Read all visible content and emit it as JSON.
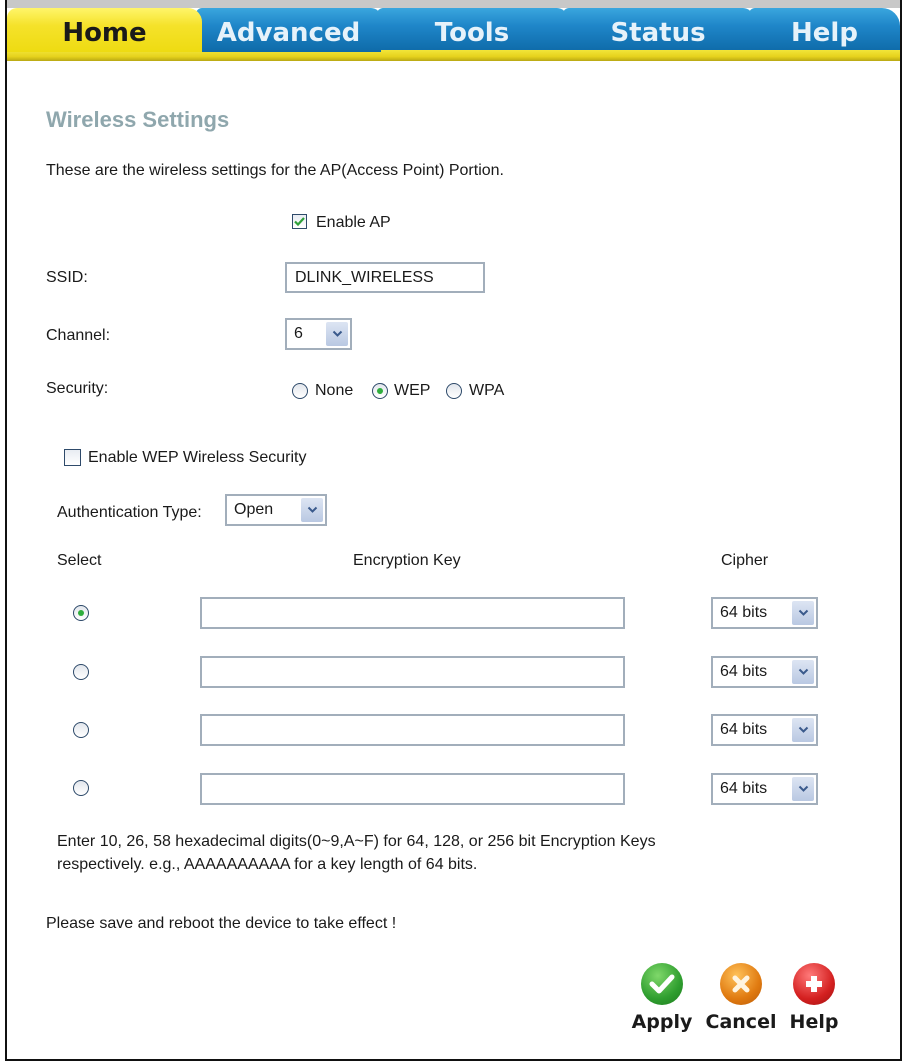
{
  "nav": {
    "tabs": [
      {
        "label": "Home",
        "active": true
      },
      {
        "label": "Advanced",
        "active": false
      },
      {
        "label": "Tools",
        "active": false
      },
      {
        "label": "Status",
        "active": false
      },
      {
        "label": "Help",
        "active": false
      }
    ]
  },
  "page": {
    "title": "Wireless Settings",
    "description": "These are the wireless settings for the AP(Access Point) Portion."
  },
  "form": {
    "enable_ap": {
      "label": "Enable AP",
      "checked": true
    },
    "ssid": {
      "label": "SSID:",
      "value": "DLINK_WIRELESS"
    },
    "channel": {
      "label": "Channel:",
      "value": "6"
    },
    "security": {
      "label": "Security:",
      "options": [
        "None",
        "WEP",
        "WPA"
      ],
      "selected": "WEP"
    },
    "enable_wep": {
      "label": "Enable WEP Wireless Security",
      "checked": false
    },
    "auth_type": {
      "label": "Authentication Type:",
      "value": "Open"
    }
  },
  "keys_table": {
    "headers": {
      "select": "Select",
      "key": "Encryption Key",
      "cipher": "Cipher"
    },
    "rows": [
      {
        "selected": true,
        "key": "",
        "cipher": "64 bits"
      },
      {
        "selected": false,
        "key": "",
        "cipher": "64 bits"
      },
      {
        "selected": false,
        "key": "",
        "cipher": "64 bits"
      },
      {
        "selected": false,
        "key": "",
        "cipher": "64 bits"
      }
    ]
  },
  "notes": {
    "hex_line1": "Enter 10, 26, 58 hexadecimal digits(0~9,A~F) for 64, 128, or 256 bit Encryption Keys",
    "hex_line2": "respectively. e.g., AAAAAAAAAA for a key length of 64 bits.",
    "reboot": "Please save and reboot the device to take effect !"
  },
  "actions": {
    "apply": {
      "label": "Apply",
      "icon": "check-icon",
      "color": "#2f9e2f"
    },
    "cancel": {
      "label": "Cancel",
      "icon": "x-icon",
      "color": "#e07a10"
    },
    "help": {
      "label": "Help",
      "icon": "plus-icon",
      "color": "#d42020"
    }
  },
  "colors": {
    "title": "#8fa7ad",
    "tab_active": "#f5e22a",
    "tab_inactive": "#1f86c9"
  }
}
